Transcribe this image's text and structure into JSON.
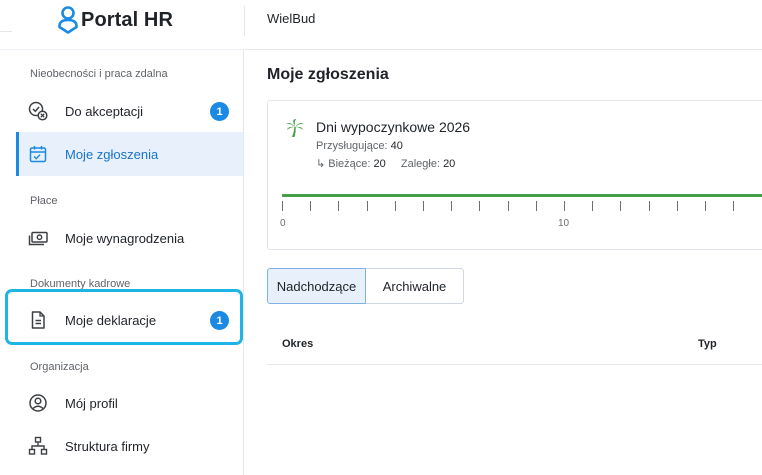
{
  "app": {
    "logo_text": "Portal HR",
    "company": "WielBud"
  },
  "colors": {
    "accent": "#1a8ae5",
    "active_bg": "#e8f1fb",
    "progress": "#43a047",
    "highlight": "#1eb4e6"
  },
  "sidebar": {
    "sections": [
      {
        "label": "Nieobecności i praca zdalna",
        "items": [
          {
            "label": "Do akceptacji",
            "icon": "approval-clock-icon",
            "badge": "1"
          },
          {
            "label": "Moje zgłoszenia",
            "icon": "calendar-check-icon",
            "active": true
          }
        ]
      },
      {
        "label": "Płace",
        "items": [
          {
            "label": "Moje wynagrodzenia",
            "icon": "money-icon"
          }
        ]
      },
      {
        "label": "Dokumenty kadrowe",
        "items": [
          {
            "label": "Moje deklaracje",
            "icon": "document-icon",
            "badge": "1",
            "highlighted": true
          }
        ]
      },
      {
        "label": "Organizacja",
        "items": [
          {
            "label": "Mój profil",
            "icon": "profile-icon"
          },
          {
            "label": "Struktura firmy",
            "icon": "org-structure-icon"
          }
        ]
      }
    ]
  },
  "main": {
    "title": "Moje zgłoszenia",
    "card": {
      "icon": "palm-tree-icon",
      "title": "Dni wypoczynkowe 2026",
      "entitled_label": "Przysługujące:",
      "entitled_value": "40",
      "arrow": "↳",
      "current_label": "Bieżące:",
      "current_value": "20",
      "overdue_label": "Zaległe:",
      "overdue_value": "20",
      "timeline": {
        "progress": 1.0,
        "labels": [
          "0",
          "10"
        ]
      }
    },
    "tabs": [
      {
        "label": "Nadchodzące",
        "active": true
      },
      {
        "label": "Archiwalne"
      }
    ],
    "table": {
      "columns": [
        "Okres",
        "Typ"
      ]
    }
  }
}
